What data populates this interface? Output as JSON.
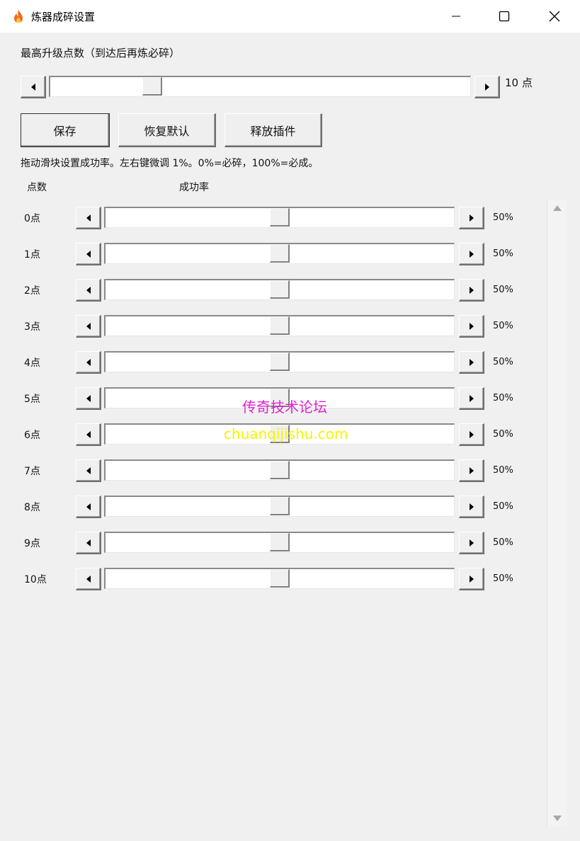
{
  "window": {
    "title": "炼器成碎设置",
    "app_icon": "flame-icon",
    "controls": [
      "minimize-icon",
      "maximize-icon",
      "close-icon"
    ]
  },
  "max_level": {
    "label": "最高升级点数（到达后再炼必碎）",
    "value": 10,
    "value_text": "10 点"
  },
  "buttons": {
    "save": "保存",
    "reset": "恢复默认",
    "release": "释放插件"
  },
  "hint": "拖动滑块设置成功率。左右键微调 1%。0%=必碎，100%=必成。",
  "columns": {
    "points": "点数",
    "rate": "成功率"
  },
  "rows": [
    {
      "label": "0点",
      "percent_text": "50%",
      "value": 50
    },
    {
      "label": "1点",
      "percent_text": "50%",
      "value": 50
    },
    {
      "label": "2点",
      "percent_text": "50%",
      "value": 50
    },
    {
      "label": "3点",
      "percent_text": "50%",
      "value": 50
    },
    {
      "label": "4点",
      "percent_text": "50%",
      "value": 50
    },
    {
      "label": "5点",
      "percent_text": "50%",
      "value": 50
    },
    {
      "label": "6点",
      "percent_text": "50%",
      "value": 50
    },
    {
      "label": "7点",
      "percent_text": "50%",
      "value": 50
    },
    {
      "label": "8点",
      "percent_text": "50%",
      "value": 50
    },
    {
      "label": "9点",
      "percent_text": "50%",
      "value": 50
    },
    {
      "label": "10点",
      "percent_text": "50%",
      "value": 50
    }
  ],
  "watermark": {
    "line1": "传奇技术论坛",
    "line2": "chuanqijishu.com",
    "color1": "#e21fd0",
    "color2": "#f5f500"
  }
}
